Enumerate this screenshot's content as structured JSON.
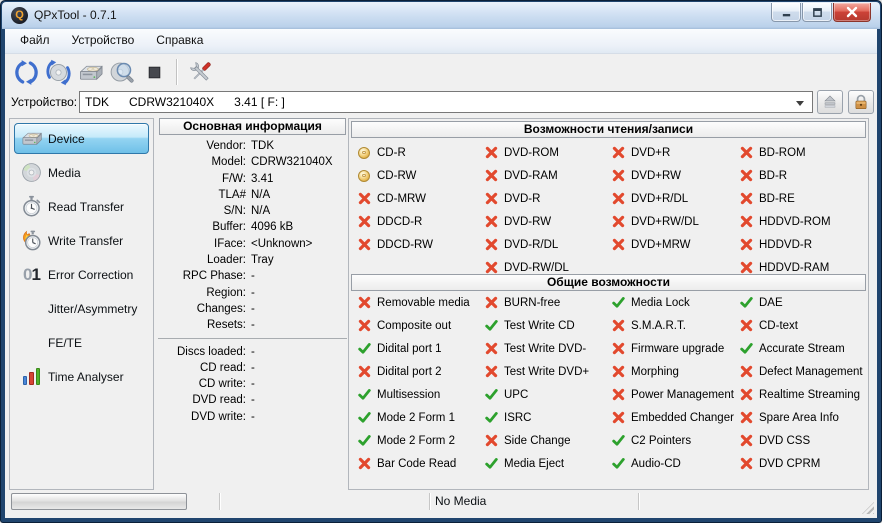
{
  "window": {
    "title": "QPxTool - 0.7.1",
    "app_icon_letter": "Q",
    "controls": [
      {
        "id": "minimize",
        "label": "minimize"
      },
      {
        "id": "maximize",
        "label": "maximize"
      },
      {
        "id": "close",
        "label": "close"
      }
    ]
  },
  "menu": {
    "items": [
      {
        "id": "file",
        "label": "Файл"
      },
      {
        "id": "device",
        "label": "Устройство"
      },
      {
        "id": "help",
        "label": "Справка"
      }
    ]
  },
  "toolbar": {
    "buttons": [
      {
        "id": "refresh",
        "icon": "refresh-icon"
      },
      {
        "id": "rescan-media",
        "icon": "rescan-media-icon"
      },
      {
        "id": "drive",
        "icon": "drive-icon"
      },
      {
        "id": "scan-media",
        "icon": "search-media-icon"
      },
      {
        "id": "stop",
        "icon": "stop-icon"
      },
      {
        "id": "separator",
        "icon": ""
      },
      {
        "id": "preferences",
        "icon": "settings-icon"
      }
    ]
  },
  "device_bar": {
    "label": "Устройство:",
    "value": "TDK      CDRW321040X      3.41 [ F: ]",
    "buttons": [
      {
        "id": "eject",
        "icon": "eject-icon"
      },
      {
        "id": "lock",
        "icon": "lock-icon"
      }
    ]
  },
  "sidebar": {
    "items": [
      {
        "id": "device",
        "label": "Device",
        "icon": "drive-icon",
        "selected": true
      },
      {
        "id": "media",
        "label": "Media",
        "icon": "disc-icon",
        "selected": false
      },
      {
        "id": "read-transfer",
        "label": "Read Transfer",
        "icon": "stopwatch-icon",
        "selected": false
      },
      {
        "id": "write-transfer",
        "label": "Write Transfer",
        "icon": "stopwatch-fire-icon",
        "selected": false
      },
      {
        "id": "error-correction",
        "label": "Error Correction",
        "icon": "zero-one-icon",
        "selected": false
      },
      {
        "id": "jitter-asymmetry",
        "label": "Jitter/Asymmetry",
        "icon": "",
        "selected": false
      },
      {
        "id": "fe-te",
        "label": "FE/TE",
        "icon": "",
        "selected": false
      },
      {
        "id": "time-analyser",
        "label": "Time Analyser",
        "icon": "barchart-icon",
        "selected": false
      }
    ]
  },
  "info_panel": {
    "title": "Основная информация",
    "rows": [
      {
        "label": "Vendor:",
        "value": "TDK"
      },
      {
        "label": "Model:",
        "value": "CDRW321040X"
      },
      {
        "label": "F/W:",
        "value": "3.41"
      },
      {
        "label": "TLA#",
        "value": "N/A"
      },
      {
        "label": "S/N:",
        "value": "N/A"
      },
      {
        "label": "Buffer:",
        "value": "4096 kB"
      },
      {
        "label": "IFace:",
        "value": "<Unknown>"
      },
      {
        "label": "Loader:",
        "value": "Tray"
      },
      {
        "label": "RPC Phase:",
        "value": "-"
      },
      {
        "label": "Region:",
        "value": "-"
      },
      {
        "label": "Changes:",
        "value": "-"
      },
      {
        "label": "Resets:",
        "value": "-"
      }
    ],
    "rows_media": [
      {
        "label": "Discs loaded:",
        "value": "-"
      },
      {
        "label": "CD read:",
        "value": "-"
      },
      {
        "label": "CD write:",
        "value": "-"
      },
      {
        "label": "DVD read:",
        "value": "-"
      },
      {
        "label": "DVD write:",
        "value": "-"
      }
    ]
  },
  "capabilities_rw": {
    "title": "Возможности чтения/записи",
    "columns": [
      [
        {
          "label": "CD-R",
          "status": "disc"
        },
        {
          "label": "CD-RW",
          "status": "disc"
        },
        {
          "label": "CD-MRW",
          "status": "no"
        },
        {
          "label": "DDCD-R",
          "status": "no"
        },
        {
          "label": "DDCD-RW",
          "status": "no"
        }
      ],
      [
        {
          "label": "DVD-ROM",
          "status": "no"
        },
        {
          "label": "DVD-RAM",
          "status": "no"
        },
        {
          "label": "DVD-R",
          "status": "no"
        },
        {
          "label": "DVD-RW",
          "status": "no"
        },
        {
          "label": "DVD-R/DL",
          "status": "no"
        },
        {
          "label": "DVD-RW/DL",
          "status": "no"
        }
      ],
      [
        {
          "label": "DVD+R",
          "status": "no"
        },
        {
          "label": "DVD+RW",
          "status": "no"
        },
        {
          "label": "DVD+R/DL",
          "status": "no"
        },
        {
          "label": "DVD+RW/DL",
          "status": "no"
        },
        {
          "label": "DVD+MRW",
          "status": "no"
        }
      ],
      [
        {
          "label": "BD-ROM",
          "status": "no"
        },
        {
          "label": "BD-R",
          "status": "no"
        },
        {
          "label": "BD-RE",
          "status": "no"
        },
        {
          "label": "HDDVD-ROM",
          "status": "no"
        },
        {
          "label": "HDDVD-R",
          "status": "no"
        },
        {
          "label": "HDDVD-RAM",
          "status": "no"
        }
      ]
    ]
  },
  "capabilities_general": {
    "title": "Общие возможности",
    "columns": [
      [
        {
          "label": "Removable media",
          "status": "no"
        },
        {
          "label": "Composite out",
          "status": "no"
        },
        {
          "label": "Didital port 1",
          "status": "yes"
        },
        {
          "label": "Didital port 2",
          "status": "no"
        },
        {
          "label": "Multisession",
          "status": "yes"
        },
        {
          "label": "Mode 2 Form 1",
          "status": "yes"
        },
        {
          "label": "Mode 2 Form 2",
          "status": "yes"
        },
        {
          "label": "Bar Code Read",
          "status": "no"
        }
      ],
      [
        {
          "label": "BURN-free",
          "status": "no"
        },
        {
          "label": "Test Write CD",
          "status": "yes"
        },
        {
          "label": "Test Write DVD-",
          "status": "no"
        },
        {
          "label": "Test Write DVD+",
          "status": "no"
        },
        {
          "label": "UPC",
          "status": "yes"
        },
        {
          "label": "ISRC",
          "status": "yes"
        },
        {
          "label": "Side Change",
          "status": "no"
        },
        {
          "label": "Media Eject",
          "status": "yes"
        }
      ],
      [
        {
          "label": "Media Lock",
          "status": "yes"
        },
        {
          "label": "S.M.A.R.T.",
          "status": "no"
        },
        {
          "label": "Firmware upgrade",
          "status": "no"
        },
        {
          "label": "Morphing",
          "status": "no"
        },
        {
          "label": "Power Management",
          "status": "no"
        },
        {
          "label": "Embedded Changer",
          "status": "no"
        },
        {
          "label": "C2 Pointers",
          "status": "yes"
        },
        {
          "label": "Audio-CD",
          "status": "yes"
        }
      ],
      [
        {
          "label": "DAE",
          "status": "yes"
        },
        {
          "label": "CD-text",
          "status": "no"
        },
        {
          "label": "Accurate Stream",
          "status": "yes"
        },
        {
          "label": "Defect Management",
          "status": "no"
        },
        {
          "label": "Realtime Streaming",
          "status": "no"
        },
        {
          "label": "Spare Area Info",
          "status": "no"
        },
        {
          "label": "DVD CSS",
          "status": "no"
        },
        {
          "label": "DVD CPRM",
          "status": "no"
        }
      ]
    ]
  },
  "status_bar": {
    "message": "No Media"
  },
  "colors": {
    "check": "#2da12d",
    "cross": "#e2492e",
    "disc_gold": "#e9bb55",
    "selection_blue": "#6fc0e8",
    "close_red": "#cc4237"
  }
}
